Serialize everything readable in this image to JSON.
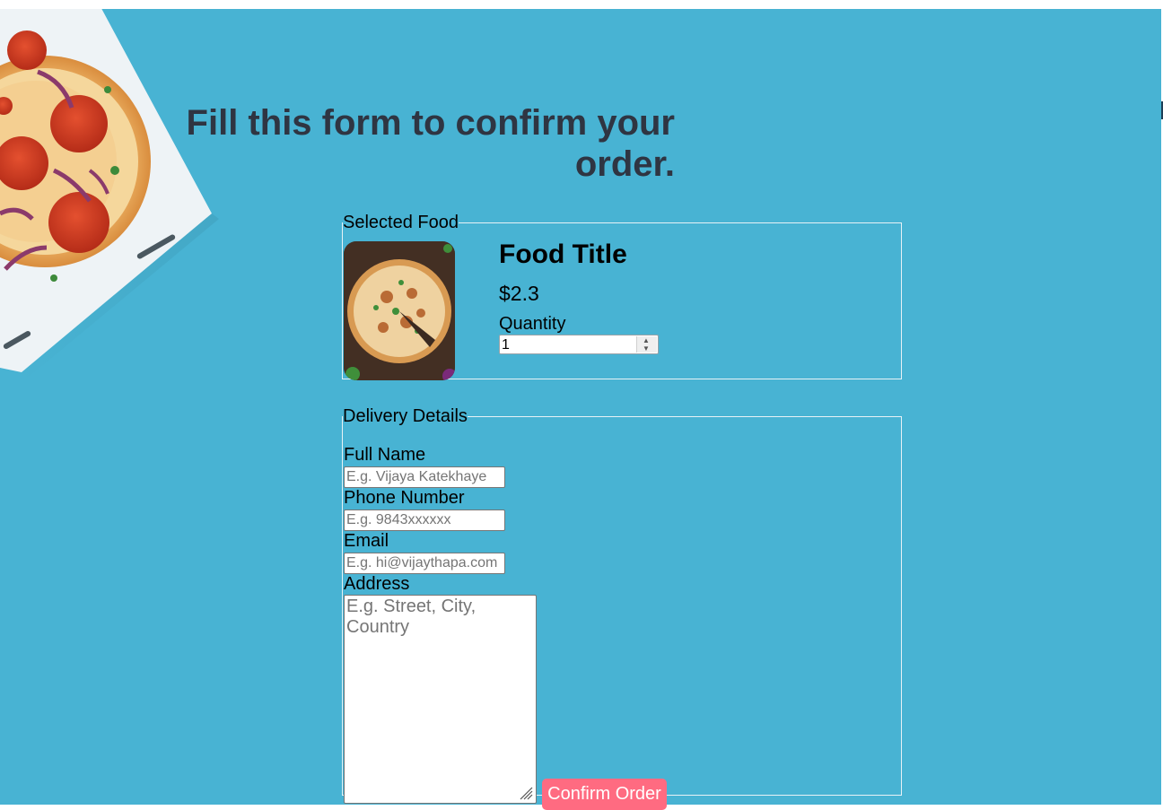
{
  "page": {
    "heading": "Fill this form to confirm your order.",
    "background_color": "#48b3d3"
  },
  "selected_food": {
    "legend": "Selected Food",
    "image_icon": "pizza-photo",
    "title": "Food Title",
    "price": "$2.3",
    "quantity_label": "Quantity",
    "quantity_value": "1"
  },
  "delivery": {
    "legend": "Delivery Details",
    "full_name_label": "Full Name",
    "full_name_placeholder": "E.g. Vijaya Katekhaye",
    "phone_label": "Phone Number",
    "phone_placeholder": "E.g. 9843xxxxxx",
    "email_label": "Email",
    "email_placeholder": "E.g. hi@vijaythapa.com",
    "address_label": "Address",
    "address_placeholder": "E.g. Street, City, Country",
    "confirm_label": "Confirm Order",
    "confirm_color": "#ff6b81"
  }
}
